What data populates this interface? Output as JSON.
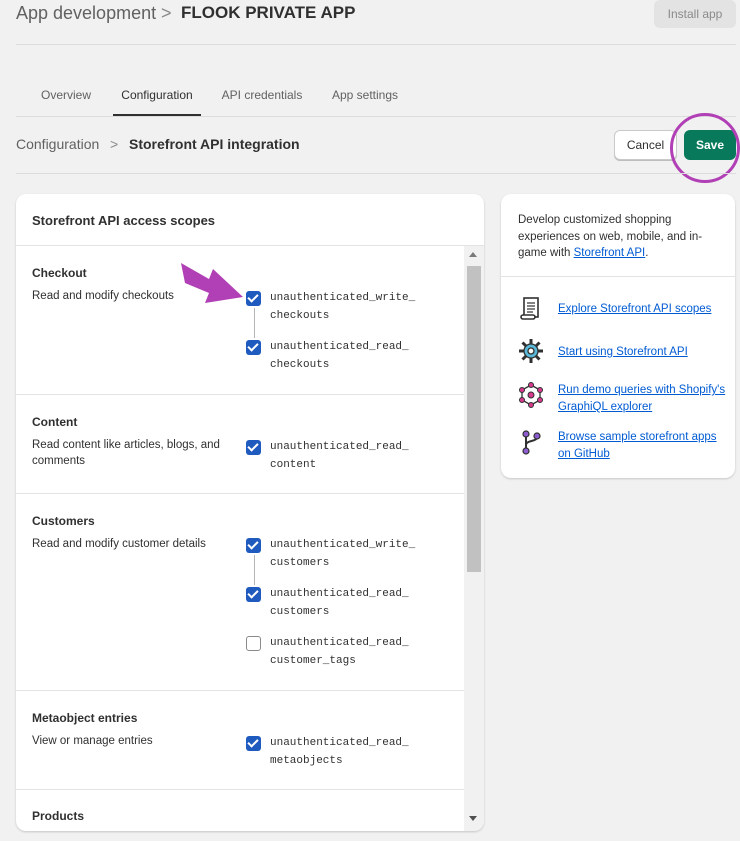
{
  "header": {
    "breadcrumb_parent": "App development",
    "breadcrumb_sep": ">",
    "app_title": "FLOOK PRIVATE APP",
    "install_label": "Install app"
  },
  "tabs": [
    {
      "label": "Overview",
      "active": false
    },
    {
      "label": "Configuration",
      "active": true
    },
    {
      "label": "API credentials",
      "active": false
    },
    {
      "label": "App settings",
      "active": false
    }
  ],
  "subheader": {
    "parent": "Configuration",
    "sep": ">",
    "current": "Storefront API integration",
    "cancel_label": "Cancel",
    "save_label": "Save"
  },
  "scopes_card": {
    "title": "Storefront API access scopes",
    "sections": [
      {
        "title": "Checkout",
        "description": "Read and modify checkouts",
        "scopes": [
          {
            "line1": "unauthenticated_write_",
            "line2": "checkouts",
            "checked": true
          },
          {
            "line1": "unauthenticated_read_",
            "line2": "checkouts",
            "checked": true
          }
        ]
      },
      {
        "title": "Content",
        "description": "Read content like articles, blogs, and comments",
        "scopes": [
          {
            "line1": "unauthenticated_read_",
            "line2": "content",
            "checked": true
          }
        ]
      },
      {
        "title": "Customers",
        "description": "Read and modify customer details",
        "scopes": [
          {
            "line1": "unauthenticated_write_",
            "line2": "customers",
            "checked": true
          },
          {
            "line1": "unauthenticated_read_",
            "line2": "customers",
            "checked": true
          },
          {
            "line1": "unauthenticated_read_",
            "line2": "customer_tags",
            "checked": false
          }
        ]
      },
      {
        "title": "Metaobject entries",
        "description": "View or manage entries",
        "scopes": [
          {
            "line1": "unauthenticated_read_",
            "line2": "metaobjects",
            "checked": true
          }
        ]
      },
      {
        "title": "Products",
        "description": "",
        "scopes": []
      }
    ]
  },
  "side_card": {
    "intro": "Develop customized shopping experiences on web, mobile, and in-game with ",
    "intro_link": "Storefront API",
    "intro_end": ".",
    "links": [
      {
        "icon": "scroll-document-icon",
        "label": "Explore Storefront API scopes"
      },
      {
        "icon": "gear-icon",
        "label": "Start using Storefront API"
      },
      {
        "icon": "graphql-icon",
        "label": "Run demo queries with Shopify's GraphiQL explorer"
      },
      {
        "icon": "git-branch-icon",
        "label": "Browse sample storefront apps on GitHub"
      }
    ]
  },
  "colors": {
    "save": "#087a5b",
    "checkbox": "#1f5bbf",
    "link": "#005bd3",
    "annotation": "#b13fb5"
  }
}
